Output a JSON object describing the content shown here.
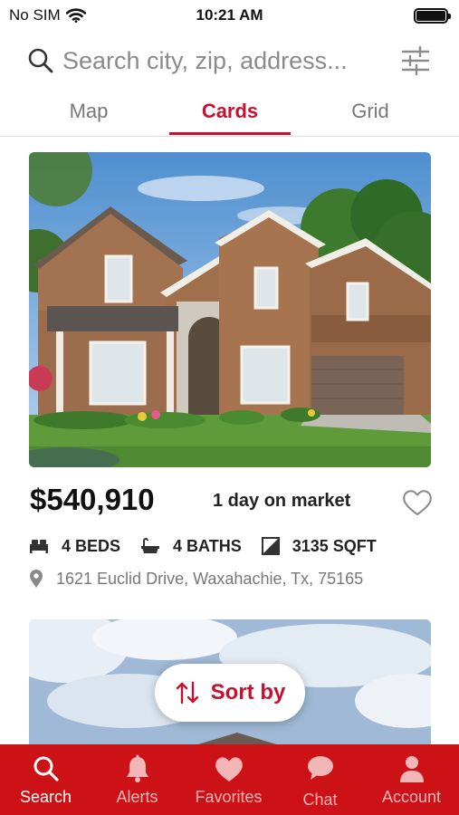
{
  "status_bar": {
    "carrier": "No SIM",
    "time": "10:21 AM",
    "icons": [
      "wifi-icon",
      "battery-icon"
    ]
  },
  "search": {
    "placeholder": "Search city, zip, address...",
    "icon": "search-icon",
    "filter_icon": "sliders-icon"
  },
  "tabs": [
    {
      "label": "Map",
      "active": false
    },
    {
      "label": "Cards",
      "active": true
    },
    {
      "label": "Grid",
      "active": false
    }
  ],
  "listing": {
    "price": "$540,910",
    "days_on_market": "1 day on market",
    "favorite": false,
    "beds": "4 BEDS",
    "baths": "4 BATHS",
    "sqft": "3135 SQFT",
    "address": "1621 Euclid Drive, Waxahachie, Tx, 75165",
    "icons": [
      "bed-icon",
      "bath-icon",
      "sqft-icon",
      "location-pin-icon",
      "heart-outline-icon"
    ]
  },
  "sort": {
    "label": "Sort by",
    "icon": "sort-arrows-icon"
  },
  "bottom_nav": {
    "items": [
      {
        "label": "Search",
        "icon": "search-icon",
        "active": true
      },
      {
        "label": "Alerts",
        "icon": "bell-icon",
        "active": false
      },
      {
        "label": "Favorites",
        "icon": "heart-icon",
        "active": false
      },
      {
        "label": "Chat",
        "icon": "chat-bubble-icon",
        "active": false
      },
      {
        "label": "Account",
        "icon": "person-icon",
        "active": false
      }
    ]
  },
  "colors": {
    "brand_red": "#c8102e",
    "nav_red": "#cc1117",
    "inactive_nav_text": "#f3b6b6",
    "muted_text": "#777777"
  }
}
